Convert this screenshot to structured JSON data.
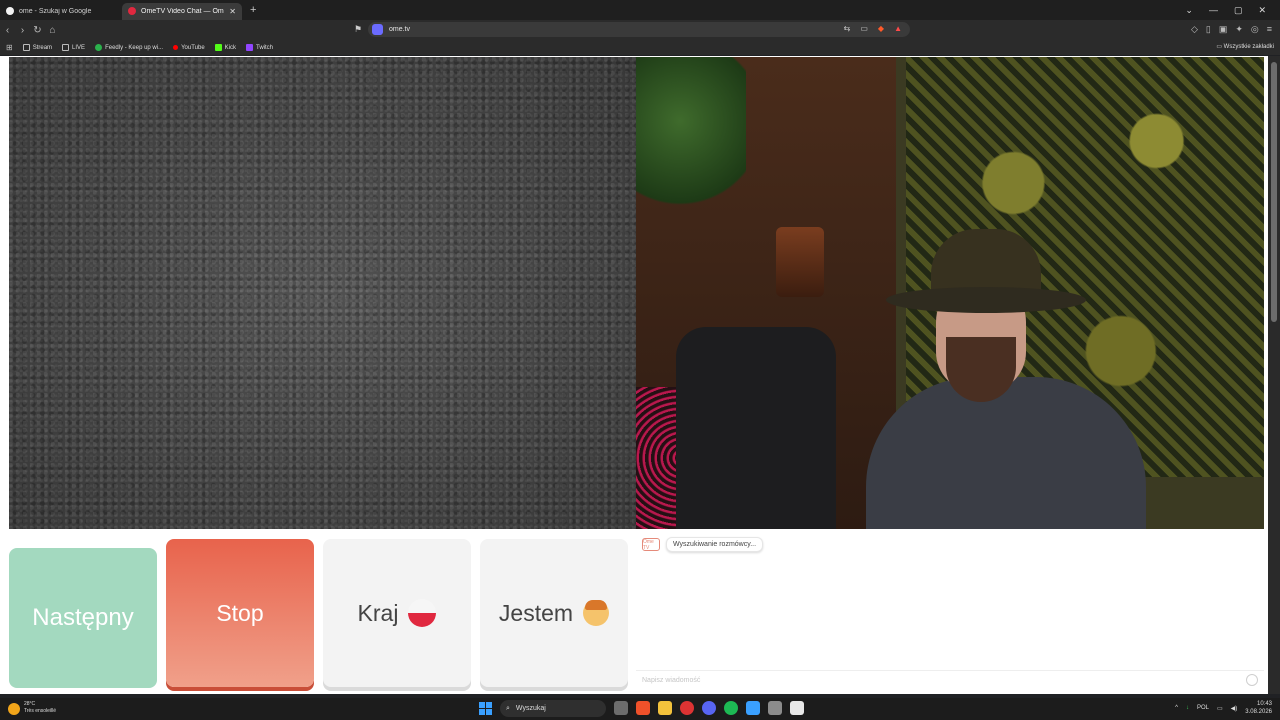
{
  "browser": {
    "tabs": [
      {
        "title": "ome - Szukaj w Google",
        "color": "#f2f2f2",
        "active": false
      },
      {
        "title": "OmeTV Video Chat — Omeg",
        "color": "#e0283f",
        "active": true
      }
    ],
    "new_tab": "+",
    "address": "ome.tv",
    "bookmarks": [
      {
        "label": "Stream",
        "color": "#888888"
      },
      {
        "label": "LIVE",
        "color": "#888888"
      },
      {
        "label": "Feedly - Keep up wi...",
        "color": "#2bb24c"
      },
      {
        "label": "YouTube",
        "color": "#ff0000"
      },
      {
        "label": "Kick",
        "color": "#53fc18"
      },
      {
        "label": "Twitch",
        "color": "#9146ff"
      }
    ],
    "all_bookmarks": "Wszystkie zakładki"
  },
  "controls": {
    "next": "Następny",
    "stop": "Stop",
    "country": "Kraj",
    "gender": "Jestem"
  },
  "chat": {
    "status": "Wyszukiwanie rozmówcy...",
    "logo_text": "Ome TV",
    "placeholder": "Napisz wiadomość"
  },
  "taskbar": {
    "temperature": "28°C",
    "weather": "Très ensoleillé",
    "search": "Wyszukaj",
    "language": "POL",
    "time": "10:43",
    "date": "3.08.2026"
  },
  "colors": {
    "next": "#a3d9bf",
    "stop": "#e8634c",
    "accent": "#6b6bff"
  }
}
